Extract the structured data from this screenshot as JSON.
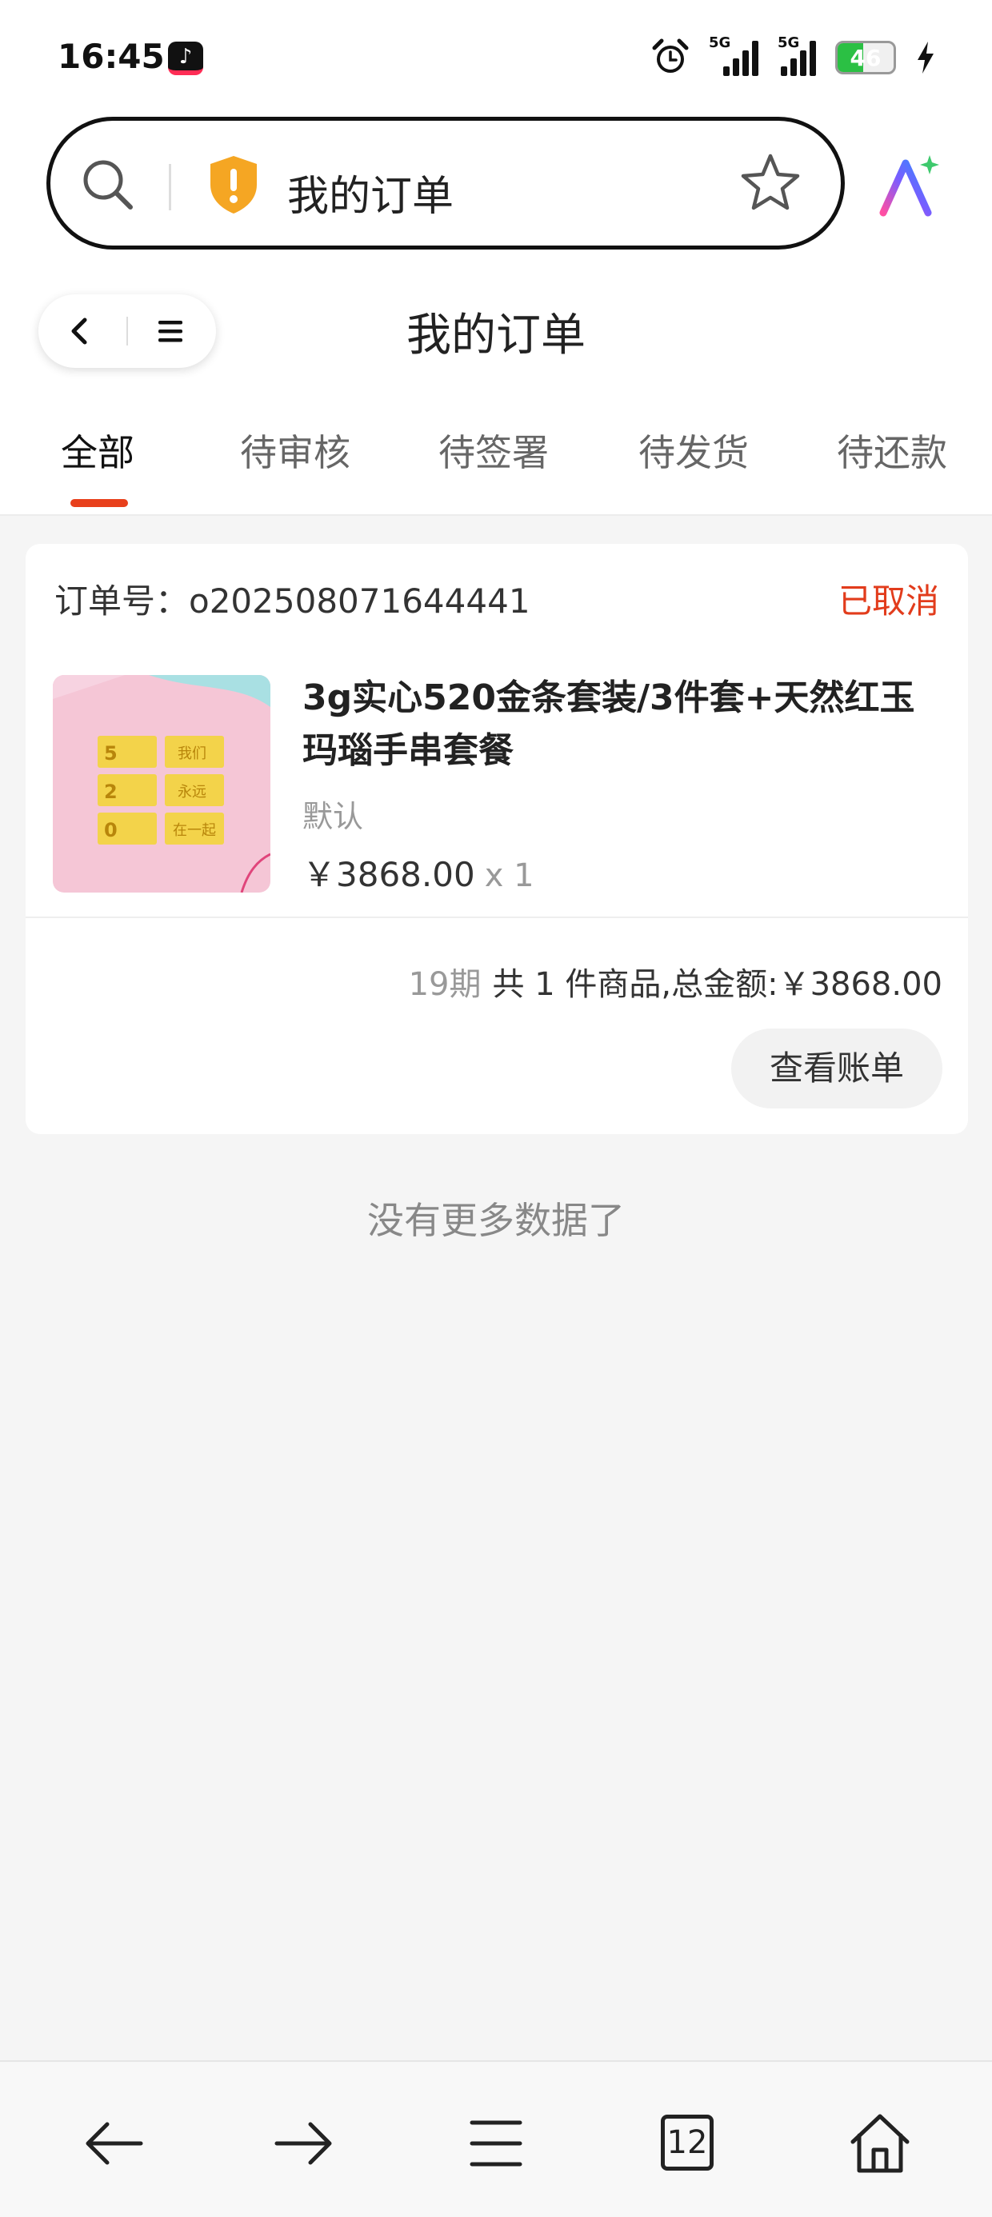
{
  "status_bar": {
    "time": "16:45",
    "app_icon": "tiktok-icon",
    "network_1": "5G",
    "network_2": "5G",
    "battery": "46",
    "battery_fraction": 0.46
  },
  "address_bar": {
    "title": "我的订单",
    "icons": [
      "search-icon",
      "shield-warning-icon",
      "star-icon",
      "ai-assistant-icon"
    ],
    "shield_color": "#f5a623"
  },
  "header": {
    "title": "我的订单"
  },
  "tabs": [
    {
      "label": "全部",
      "active": true
    },
    {
      "label": "待审核",
      "active": false
    },
    {
      "label": "待签署",
      "active": false
    },
    {
      "label": "待发货",
      "active": false
    },
    {
      "label": "待还款",
      "active": false
    }
  ],
  "order": {
    "order_no_label": "订单号：",
    "order_no": "o202508071644441",
    "status": "已取消",
    "product_name": "3g实心520金条套装/3件套+天然红玉玛瑙手串套餐",
    "spec": "默认",
    "price": "￥3868.00",
    "qty": "x 1",
    "period": "19期",
    "summary": "共 1 件商品,总金额:￥3868.00",
    "view_bill": "查看账单",
    "image_labels": {
      "a": "5",
      "b": "我们",
      "c": "2",
      "d": "永远",
      "e": "0",
      "f": "在一起"
    }
  },
  "no_more": "没有更多数据了",
  "bottom_nav": {
    "tab_count": "12",
    "icons": [
      "back-arrow-icon",
      "forward-arrow-icon",
      "menu-icon",
      "tabs-icon",
      "home-icon"
    ]
  },
  "colors": {
    "accent": "#e8401c",
    "status_cancelled": "#e23c1c"
  }
}
